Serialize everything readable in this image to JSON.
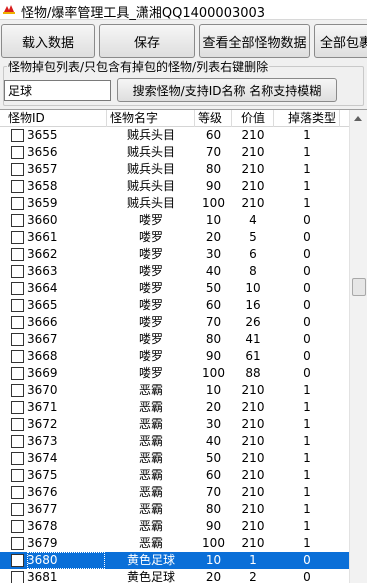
{
  "window": {
    "title": "怪物/爆率管理工具_潇湘QQ1400003003"
  },
  "toolbar": {
    "load_label": "载入数据",
    "save_label": "保存",
    "view_all_label": "查看全部怪物数据",
    "all_drops_label": "全部包裹"
  },
  "filter": {
    "caption": "怪物掉包列表/只包含有掉包的怪物/列表右键删除",
    "search_value": "足球",
    "search_button_label": "搜索怪物/支持ID名称 名称支持模糊"
  },
  "table": {
    "headers": [
      "怪物ID",
      "怪物名字",
      "等级",
      "价值",
      "掉落类型"
    ],
    "selected_index": 25,
    "rows": [
      {
        "id": "3655",
        "name": "贼兵头目",
        "level": "60",
        "price": "210",
        "type": "1"
      },
      {
        "id": "3656",
        "name": "贼兵头目",
        "level": "70",
        "price": "210",
        "type": "1"
      },
      {
        "id": "3657",
        "name": "贼兵头目",
        "level": "80",
        "price": "210",
        "type": "1"
      },
      {
        "id": "3658",
        "name": "贼兵头目",
        "level": "90",
        "price": "210",
        "type": "1"
      },
      {
        "id": "3659",
        "name": "贼兵头目",
        "level": "100",
        "price": "210",
        "type": "1"
      },
      {
        "id": "3660",
        "name": "喽罗",
        "level": "10",
        "price": "4",
        "type": "0"
      },
      {
        "id": "3661",
        "name": "喽罗",
        "level": "20",
        "price": "5",
        "type": "0"
      },
      {
        "id": "3662",
        "name": "喽罗",
        "level": "30",
        "price": "6",
        "type": "0"
      },
      {
        "id": "3663",
        "name": "喽罗",
        "level": "40",
        "price": "8",
        "type": "0"
      },
      {
        "id": "3664",
        "name": "喽罗",
        "level": "50",
        "price": "10",
        "type": "0"
      },
      {
        "id": "3665",
        "name": "喽罗",
        "level": "60",
        "price": "16",
        "type": "0"
      },
      {
        "id": "3666",
        "name": "喽罗",
        "level": "70",
        "price": "26",
        "type": "0"
      },
      {
        "id": "3667",
        "name": "喽罗",
        "level": "80",
        "price": "41",
        "type": "0"
      },
      {
        "id": "3668",
        "name": "喽罗",
        "level": "90",
        "price": "61",
        "type": "0"
      },
      {
        "id": "3669",
        "name": "喽罗",
        "level": "100",
        "price": "88",
        "type": "0"
      },
      {
        "id": "3670",
        "name": "恶霸",
        "level": "10",
        "price": "210",
        "type": "1"
      },
      {
        "id": "3671",
        "name": "恶霸",
        "level": "20",
        "price": "210",
        "type": "1"
      },
      {
        "id": "3672",
        "name": "恶霸",
        "level": "30",
        "price": "210",
        "type": "1"
      },
      {
        "id": "3673",
        "name": "恶霸",
        "level": "40",
        "price": "210",
        "type": "1"
      },
      {
        "id": "3674",
        "name": "恶霸",
        "level": "50",
        "price": "210",
        "type": "1"
      },
      {
        "id": "3675",
        "name": "恶霸",
        "level": "60",
        "price": "210",
        "type": "1"
      },
      {
        "id": "3676",
        "name": "恶霸",
        "level": "70",
        "price": "210",
        "type": "1"
      },
      {
        "id": "3677",
        "name": "恶霸",
        "level": "80",
        "price": "210",
        "type": "1"
      },
      {
        "id": "3678",
        "name": "恶霸",
        "level": "90",
        "price": "210",
        "type": "1"
      },
      {
        "id": "3679",
        "name": "恶霸",
        "level": "100",
        "price": "210",
        "type": "1"
      },
      {
        "id": "3680",
        "name": "黄色足球",
        "level": "10",
        "price": "1",
        "type": "0"
      },
      {
        "id": "3681",
        "name": "黄色足球",
        "level": "20",
        "price": "2",
        "type": "0"
      }
    ]
  },
  "colors": {
    "selection": "#0a6fd8",
    "app_icon": "#d81e1e"
  },
  "icons": {
    "app": "app-logo-icon",
    "scroll_up": "scroll-up-arrow-icon"
  }
}
